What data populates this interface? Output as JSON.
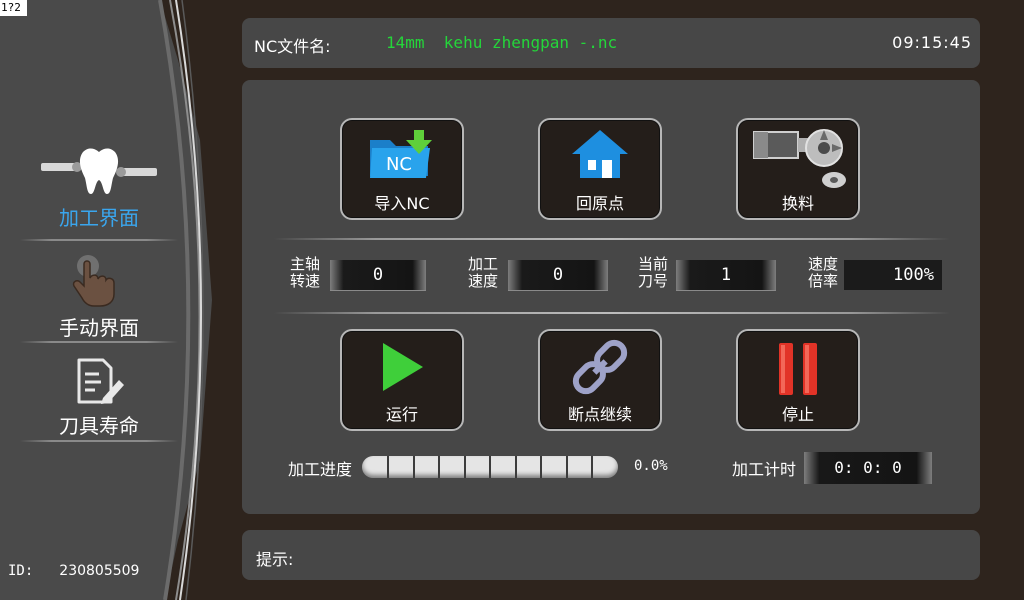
{
  "corner_tag": "1?2",
  "sidebar": {
    "items": [
      {
        "label": "加工界面",
        "icon": "tooth-icon",
        "active": true
      },
      {
        "label": "手动界面",
        "icon": "hand-pointer-icon",
        "active": false
      },
      {
        "label": "刀具寿命",
        "icon": "document-edit-icon",
        "active": false
      }
    ],
    "device_id_label": "ID:",
    "device_id_value": "230805509"
  },
  "header": {
    "nc_label": "NC文件名:",
    "nc_file": "14mm  kehu zhengpan -.nc",
    "clock": "09:15:45"
  },
  "actions_top": [
    {
      "label": "导入NC",
      "icon": "nc-folder-import-icon",
      "icon_text": "NC"
    },
    {
      "label": "回原点",
      "icon": "home-icon"
    },
    {
      "label": "换料",
      "icon": "tool-change-icon"
    }
  ],
  "params": [
    {
      "label_line1": "主轴",
      "label_line2": "转速",
      "value": "0"
    },
    {
      "label_line1": "加工",
      "label_line2": "速度",
      "value": "0"
    },
    {
      "label_line1": "当前",
      "label_line2": "刀号",
      "value": "1"
    },
    {
      "label_line1": "速度",
      "label_line2": "倍率",
      "value": "100%"
    }
  ],
  "actions_bottom": [
    {
      "label": "运行",
      "icon": "play-icon"
    },
    {
      "label": "断点继续",
      "icon": "chain-link-icon"
    },
    {
      "label": "停止",
      "icon": "pause-icon"
    }
  ],
  "progress": {
    "label": "加工进度",
    "value": 0.0,
    "text": "0.0%"
  },
  "timer": {
    "label": "加工计时",
    "value": "0: 0: 0"
  },
  "hint": {
    "label": "提示:",
    "text": ""
  },
  "colors": {
    "accent": "#3aa6ee",
    "filename": "#24d63a",
    "panel": "#474747",
    "background": "#2e241d"
  }
}
